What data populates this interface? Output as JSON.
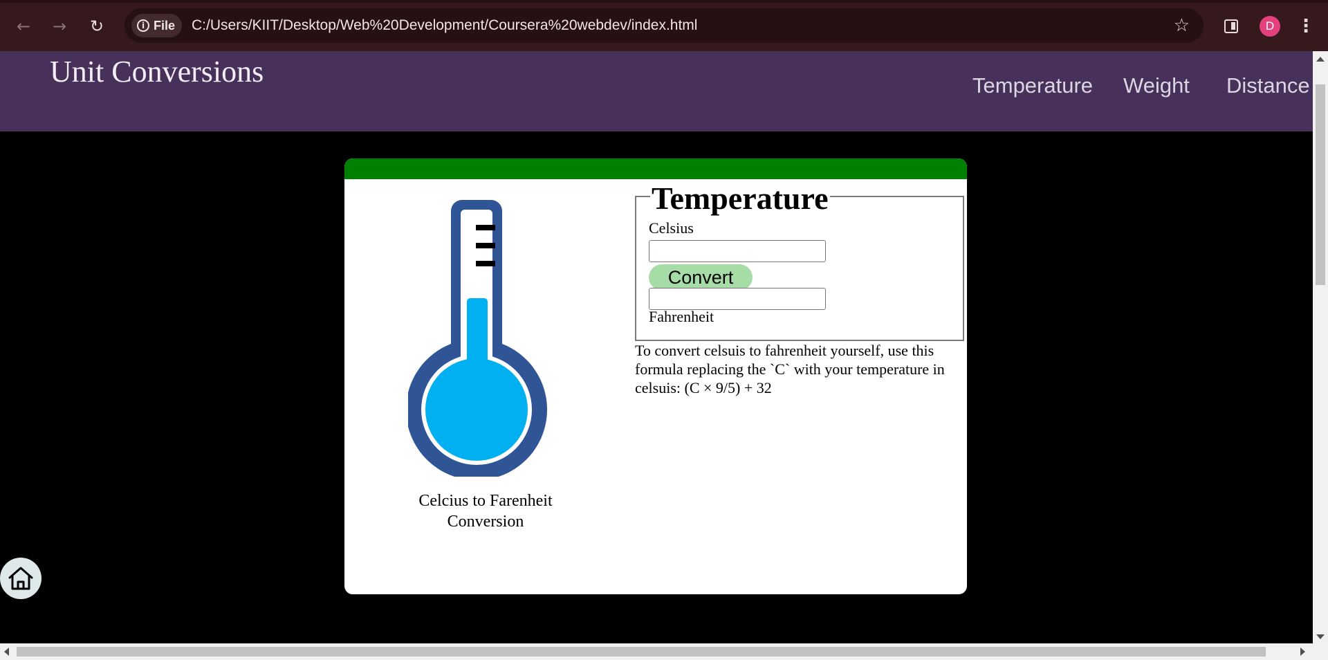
{
  "browser": {
    "site_chip_label": "File",
    "url": "C:/Users/KIIT/Desktop/Web%20Development/Coursera%20webdev/index.html",
    "avatar_initial": "D",
    "avatar_color": "#e5407e",
    "icons": [
      "back-arrow-icon",
      "forward-arrow-icon",
      "reload-icon",
      "info-icon",
      "bookmark-star-icon",
      "side-panel-icon",
      "more-menu-icon"
    ]
  },
  "header": {
    "title": "Unit Conversions",
    "nav": [
      {
        "label": "Temperature"
      },
      {
        "label": "Weight"
      },
      {
        "label": "Distance"
      }
    ],
    "background_color": "#47305a"
  },
  "card": {
    "accent_color": "#008000",
    "image_caption": "Celcius to Farenheit Conversion",
    "form": {
      "legend": "Temperature",
      "input_label": "Celsius",
      "input_value": "",
      "button_label": "Convert",
      "output_value": "",
      "output_label": "Fahrenheit"
    },
    "formula_text": "To convert celsuis to fahrenheit yourself, use this formula replacing the `C` with your temperature in celsuis: (C × 9/5) + 32"
  },
  "home_button_icon": "home-icon"
}
